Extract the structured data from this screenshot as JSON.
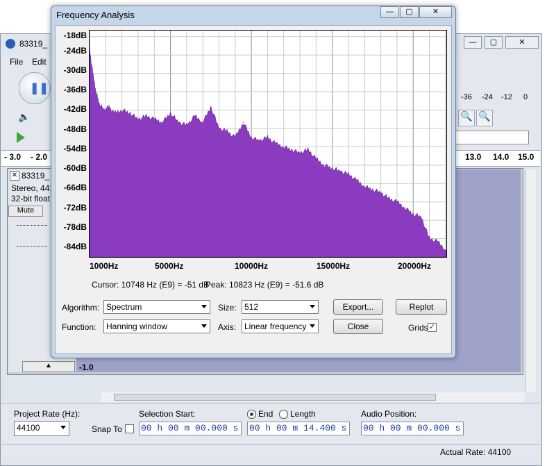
{
  "main_window": {
    "title": "83319_",
    "menu": [
      "File",
      "Edit"
    ],
    "meter_ticks": [
      "-36",
      "-24",
      "-12",
      "0"
    ],
    "timeline_left": [
      "- 3.0",
      "- 2.0"
    ],
    "timeline_right": [
      "13.0",
      "14.0",
      "15.0"
    ],
    "track": {
      "name": "83319_",
      "info1": "Stereo, 441",
      "info2": "32-bit float",
      "mute": "Mute",
      "scale_bottom": "-1.0"
    },
    "project_rate_label": "Project Rate (Hz):",
    "project_rate_value": "44100",
    "snap_to_label": "Snap To",
    "selection_start_label": "Selection Start:",
    "end_label": "End",
    "length_label": "Length",
    "audio_position_label": "Audio Position:",
    "selection_start_value": "00 h 00 m 00.000 s",
    "end_value": "00 h 00 m 14.400 s",
    "audio_position_value": "00 h 00 m 00.000 s",
    "status": "Actual Rate: 44100"
  },
  "dialog": {
    "title": "Frequency Analysis",
    "cursor_text": "Cursor: 10748 Hz (E9) = -51 dB",
    "peak_text": "Peak: 10823 Hz (E9) = -51.6 dB",
    "algorithm_label": "Algorithm:",
    "algorithm_value": "Spectrum",
    "function_label": "Function:",
    "function_value": "Hanning window",
    "size_label": "Size:",
    "size_value": "512",
    "axis_label": "Axis:",
    "axis_value": "Linear frequency",
    "export_button": "Export...",
    "replot_button": "Replot",
    "close_button": "Close",
    "grids_label": "Grids",
    "grids_checked": true
  },
  "chart_data": {
    "type": "area",
    "color": "#8a3bbf",
    "y_ticks": [
      "-18dB",
      "-24dB",
      "-30dB",
      "-36dB",
      "-42dB",
      "-48dB",
      "-54dB",
      "-60dB",
      "-66dB",
      "-72dB",
      "-78dB",
      "-84dB"
    ],
    "x_ticks": [
      "1000Hz",
      "5000Hz",
      "10000Hz",
      "15000Hz",
      "20000Hz"
    ],
    "xlim": [
      0,
      22050
    ],
    "ylim": [
      -90,
      -16
    ],
    "grid": true,
    "x": [
      0,
      200,
      400,
      600,
      900,
      1200,
      1500,
      2000,
      2500,
      3000,
      3500,
      4000,
      4500,
      5000,
      5500,
      6000,
      6500,
      7000,
      7500,
      8000,
      8500,
      9000,
      9500,
      10000,
      10500,
      11000,
      11500,
      12000,
      12500,
      13000,
      13500,
      14000,
      14500,
      15000,
      15500,
      16000,
      16500,
      17000,
      17500,
      18000,
      18500,
      19000,
      19500,
      20000,
      20500,
      21000,
      21500,
      22050
    ],
    "y": [
      -22,
      -30,
      -36,
      -40,
      -42,
      -41,
      -43,
      -42,
      -43,
      -45,
      -44,
      -45,
      -46,
      -43,
      -46,
      -47,
      -44,
      -46,
      -41,
      -48,
      -49,
      -51,
      -46,
      -51,
      -52,
      -51,
      -53,
      -54,
      -55,
      -56,
      -55,
      -58,
      -60,
      -61,
      -62,
      -63,
      -65,
      -67,
      -68,
      -69,
      -71,
      -72,
      -74,
      -76,
      -77,
      -84,
      -85,
      -88
    ]
  }
}
